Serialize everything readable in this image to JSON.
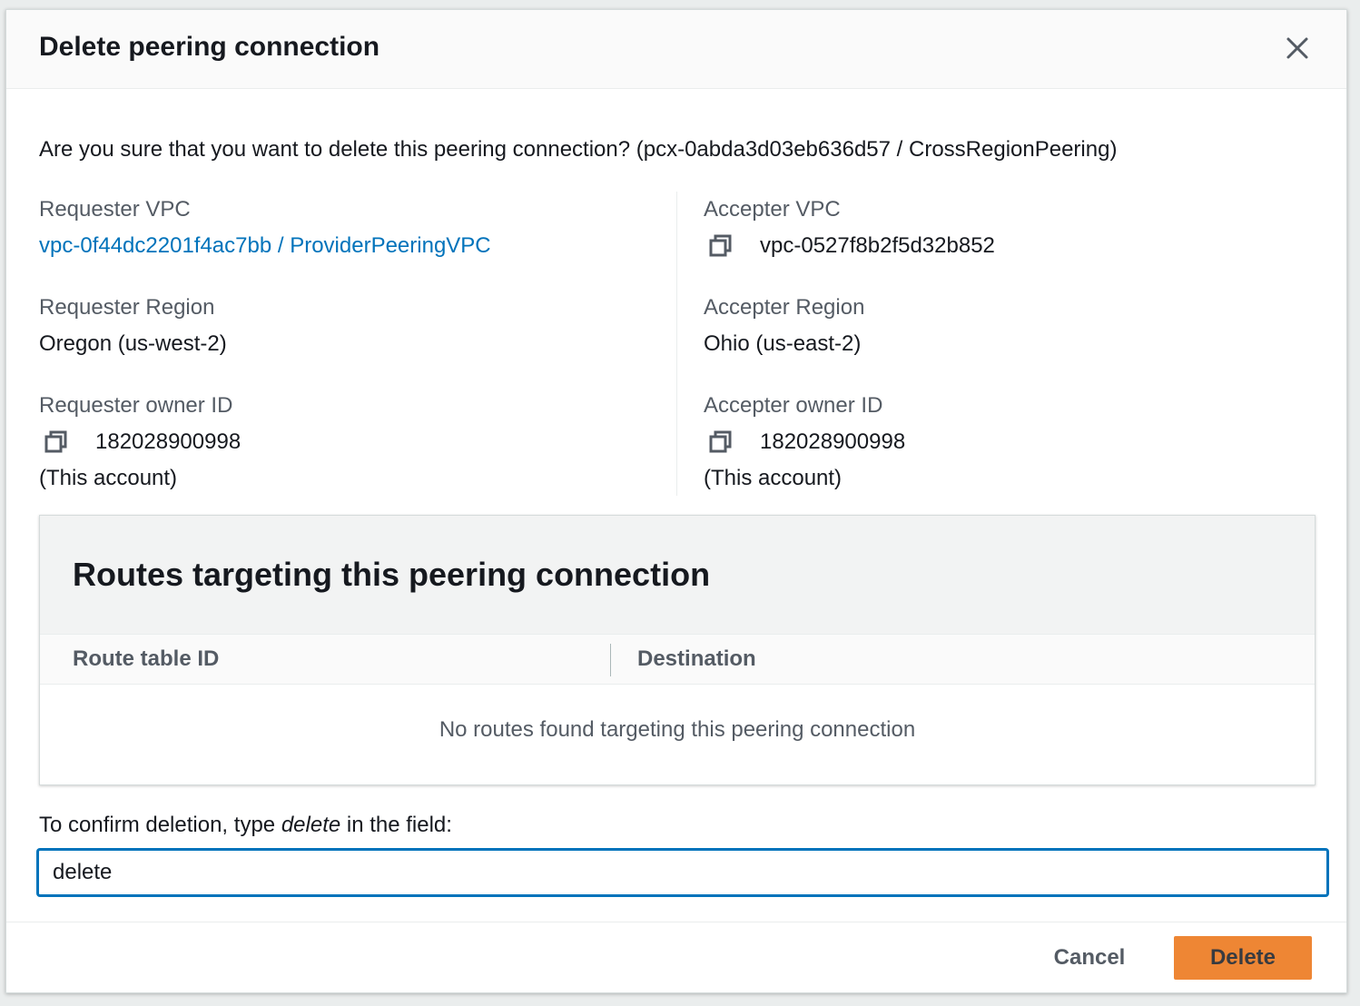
{
  "modal": {
    "title": "Delete peering connection",
    "question": "Are you sure that you want to delete this peering connection? (pcx-0abda3d03eb636d57 / CrossRegionPeering)"
  },
  "requester": {
    "vpc_label": "Requester VPC",
    "vpc_value": "vpc-0f44dc2201f4ac7bb / ProviderPeeringVPC",
    "region_label": "Requester Region",
    "region_value": "Oregon (us-west-2)",
    "owner_label": "Requester owner ID",
    "owner_value": "182028900998",
    "owner_note": "(This account)"
  },
  "accepter": {
    "vpc_label": "Accepter VPC",
    "vpc_value": "vpc-0527f8b2f5d32b852",
    "region_label": "Accepter Region",
    "region_value": "Ohio (us-east-2)",
    "owner_label": "Accepter owner ID",
    "owner_value": "182028900998",
    "owner_note": "(This account)"
  },
  "routes": {
    "title": "Routes targeting this peering connection",
    "columns": [
      "Route table ID",
      "Destination"
    ],
    "empty_message": "No routes found targeting this peering connection"
  },
  "confirm": {
    "label_prefix": "To confirm deletion, type ",
    "label_keyword": "delete",
    "label_suffix": " in the field:",
    "input_value": "delete"
  },
  "footer": {
    "cancel_label": "Cancel",
    "delete_label": "Delete"
  },
  "colors": {
    "link": "#0073bb",
    "primary_button": "#ec7211",
    "focus_border": "#0073bb"
  }
}
